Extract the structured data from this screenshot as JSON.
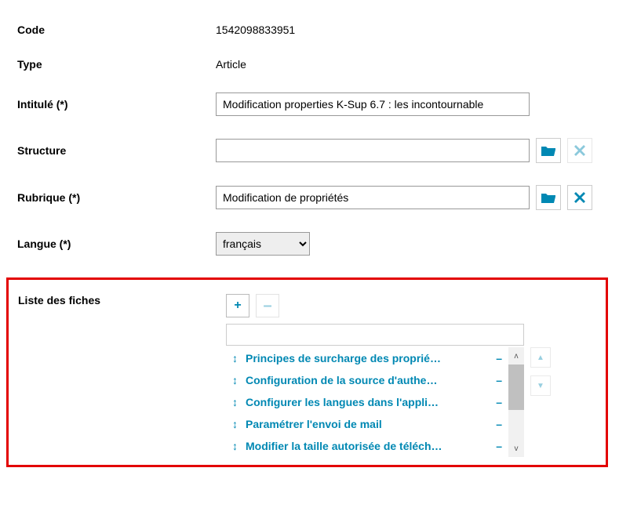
{
  "labels": {
    "code": "Code",
    "type": "Type",
    "intitule": "Intitulé (*)",
    "structure": "Structure",
    "rubrique": "Rubrique (*)",
    "langue": "Langue (*)",
    "liste_fiches": "Liste des fiches"
  },
  "values": {
    "code": "1542098833951",
    "type": "Article",
    "intitule": "Modification properties K-Sup 6.7 : les incontournable",
    "structure": "",
    "rubrique": "Modification de propriétés",
    "langue": "français"
  },
  "langue_options": [
    "français"
  ],
  "fiches": [
    "Principes de surcharge des proprié…",
    "Configuration de la source d'authe…",
    "Configurer les langues dans l'appli…",
    "Paramétrer l'envoi de mail",
    "Modifier la taille autorisée de téléch…"
  ],
  "icons": {
    "folder": "folder-icon",
    "clear": "close-icon",
    "plus": "+",
    "minus": "–",
    "drag": "↕",
    "remove": "–",
    "up": "▲",
    "down": "▼"
  },
  "colors": {
    "accent": "#0088b3",
    "highlight_border": "#e30000"
  }
}
